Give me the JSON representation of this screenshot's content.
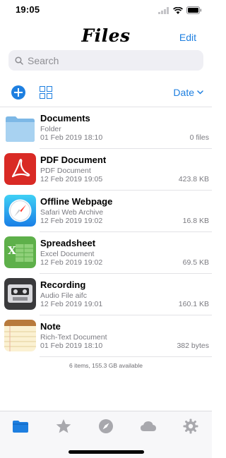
{
  "status": {
    "time": "19:05"
  },
  "nav": {
    "title": "Files",
    "edit_label": "Edit"
  },
  "search": {
    "placeholder": "Search"
  },
  "toolbar": {
    "sort_label": "Date"
  },
  "files": [
    {
      "name": "Documents",
      "type": "Folder",
      "date": "01 Feb 2019 18:10",
      "size": "0 files",
      "icon": "folder-icon"
    },
    {
      "name": "PDF Document",
      "type": "PDF Document",
      "date": "12 Feb 2019 19:05",
      "size": "423.8 KB",
      "icon": "pdf-icon"
    },
    {
      "name": "Offline Webpage",
      "type": "Safari Web Archive",
      "date": "12 Feb 2019 19:02",
      "size": "16.8 KB",
      "icon": "safari-icon"
    },
    {
      "name": "Spreadsheet",
      "type": "Excel Document",
      "date": "12 Feb 2019 19:02",
      "size": "69.5 KB",
      "icon": "spreadsheet-icon"
    },
    {
      "name": "Recording",
      "type": "Audio File aifc",
      "date": "12 Feb 2019 19:01",
      "size": "160.1 KB",
      "icon": "cassette-icon"
    },
    {
      "name": "Note",
      "type": "Rich-Text Document",
      "date": "01 Feb 2019 18:10",
      "size": "382 bytes",
      "icon": "notepad-icon"
    }
  ],
  "summary": "6 items, 155.3 GB available",
  "tabs": [
    {
      "id": "files",
      "icon": "folder-icon",
      "active": true
    },
    {
      "id": "favorites",
      "icon": "star-icon",
      "active": false
    },
    {
      "id": "browse",
      "icon": "compass-icon",
      "active": false
    },
    {
      "id": "cloud",
      "icon": "cloud-icon",
      "active": false
    },
    {
      "id": "settings",
      "icon": "gear-icon",
      "active": false
    }
  ],
  "colors": {
    "accent": "#1e7fe0",
    "inactive_tab": "#a8a8ad",
    "secondary_text": "#7a7a80"
  }
}
